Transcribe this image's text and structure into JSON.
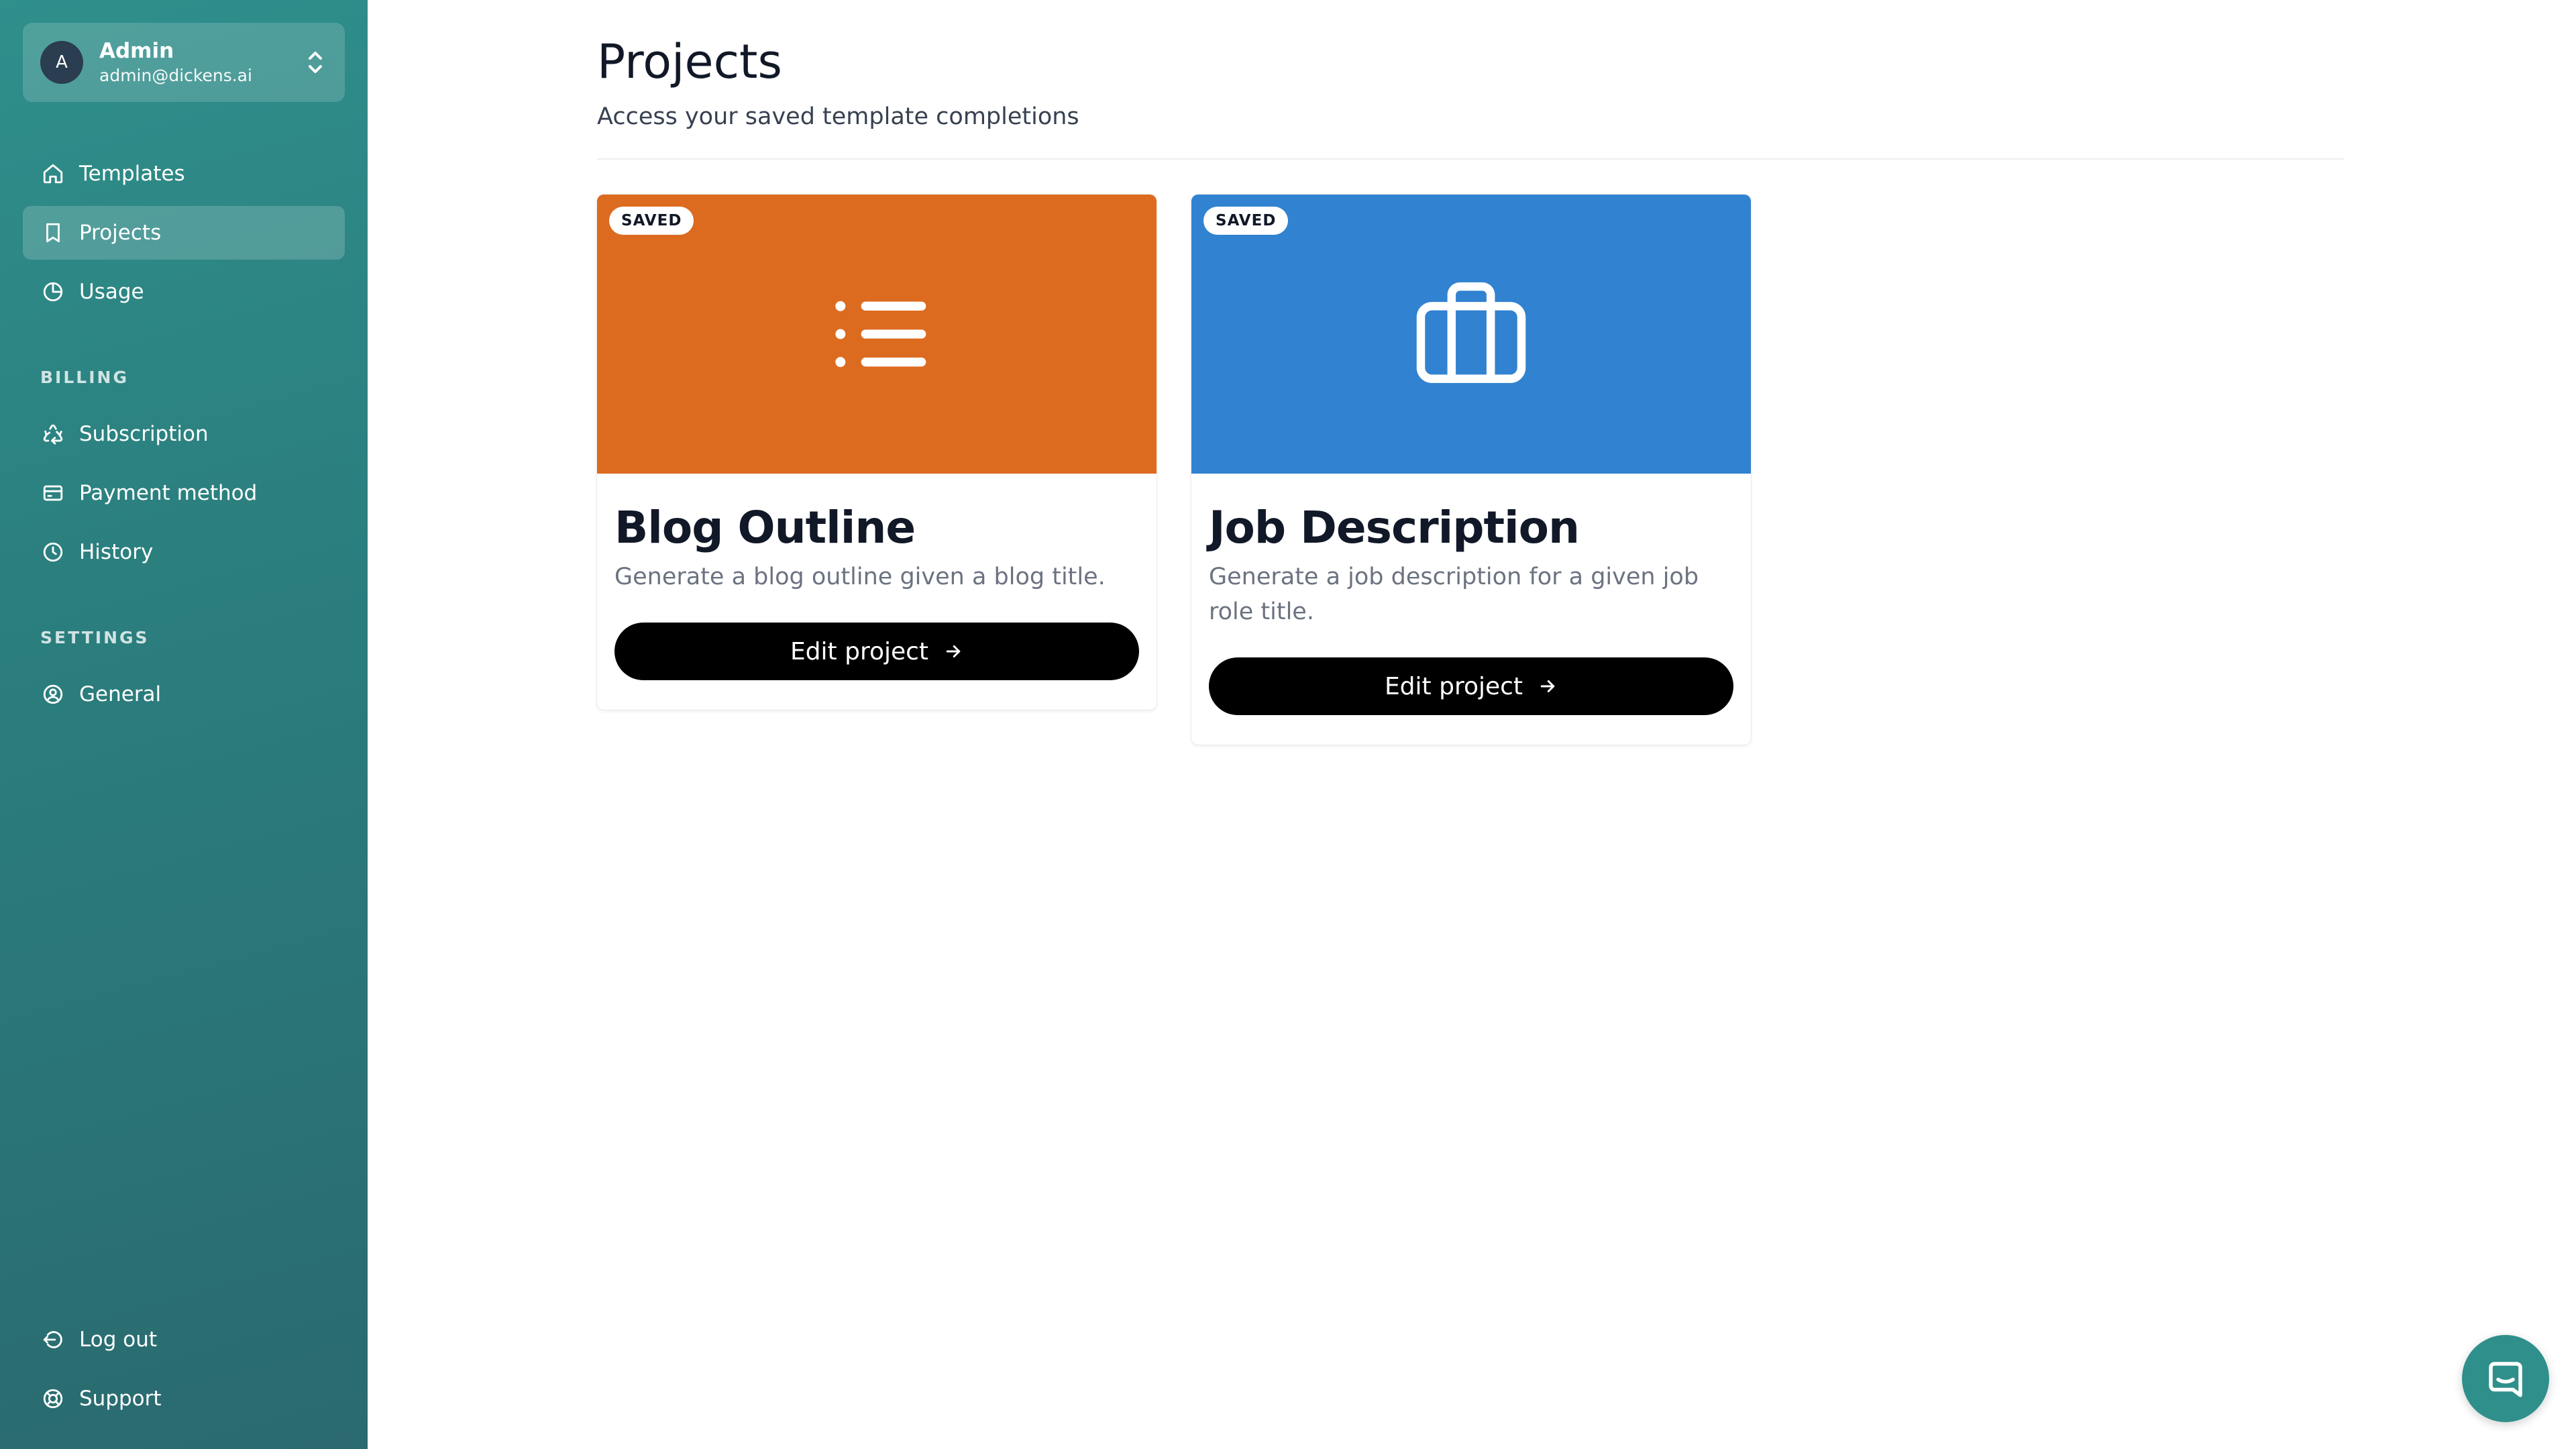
{
  "account": {
    "avatar_initial": "A",
    "name": "Admin",
    "email": "admin@dickens.ai"
  },
  "nav": {
    "templates": "Templates",
    "projects": "Projects",
    "usage": "Usage",
    "billing_label": "BILLING",
    "subscription": "Subscription",
    "payment_method": "Payment method",
    "history": "History",
    "settings_label": "SETTINGS",
    "general": "General",
    "log_out": "Log out",
    "support": "Support",
    "active": "projects"
  },
  "page": {
    "title": "Projects",
    "subtitle": "Access your saved template completions"
  },
  "cards": [
    {
      "badge": "SAVED",
      "title": "Blog Outline",
      "description": "Generate a blog outline given a blog title.",
      "button_label": "Edit project",
      "banner_color": "#dc6b20",
      "icon": "list-icon"
    },
    {
      "badge": "SAVED",
      "title": "Job Description",
      "description": "Generate a job description for a given job role title.",
      "button_label": "Edit project",
      "banner_color": "#3182d0",
      "icon": "briefcase-icon"
    }
  ],
  "colors": {
    "sidebar": "#2b7f7e",
    "accent": "#2f8f8b",
    "button": "#000000"
  }
}
